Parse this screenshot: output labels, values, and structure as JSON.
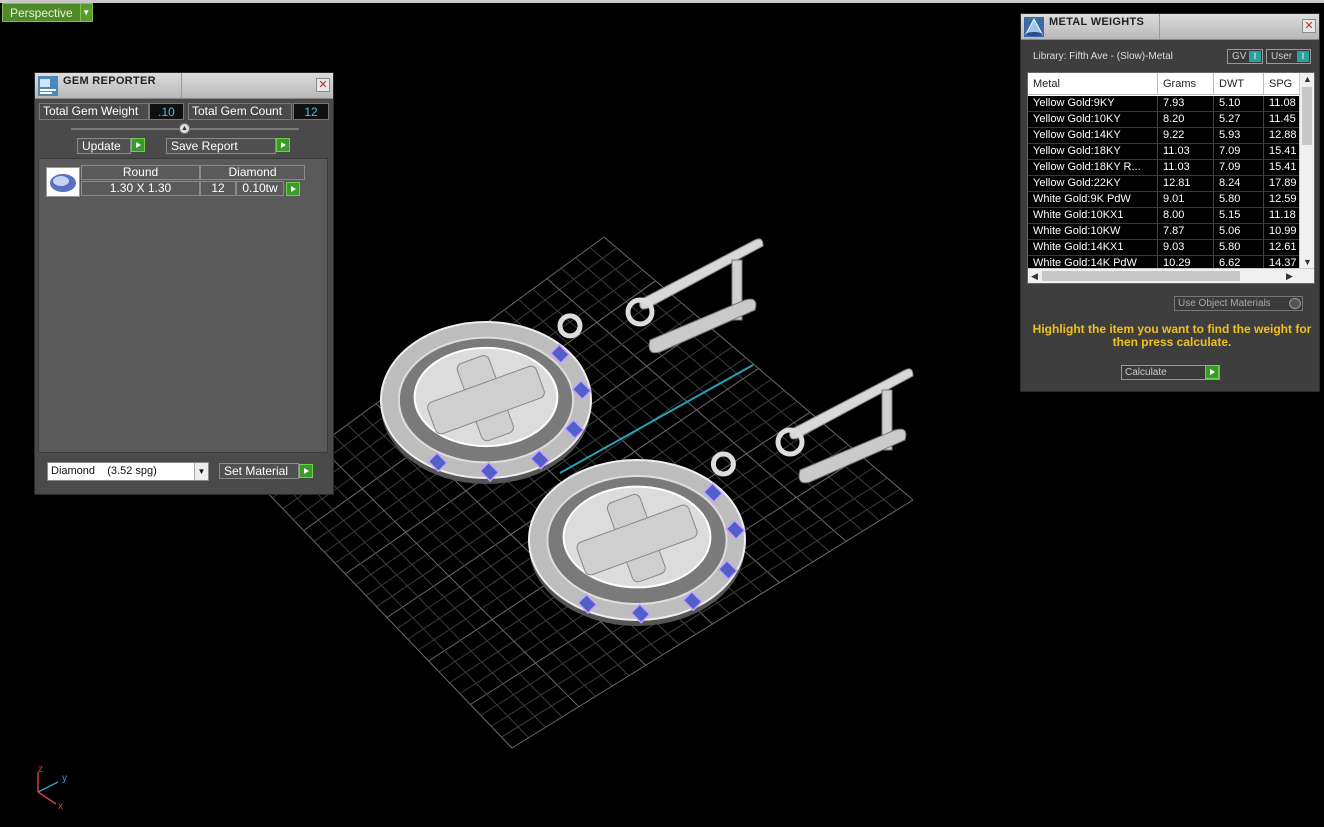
{
  "viewport": {
    "view_label": "Perspective",
    "axes": {
      "z": "z",
      "y": "y",
      "x": "x"
    }
  },
  "gem_reporter": {
    "title": "GEM REPORTER",
    "total_weight_label": "Total Gem Weight",
    "total_weight_value": ".10",
    "total_count_label": "Total Gem Count",
    "total_count_value": "12",
    "update_label": "Update",
    "save_label": "Save Report",
    "columns": {
      "shape": "Round",
      "material": "Diamond"
    },
    "gem": {
      "size": "1.30 X 1.30",
      "count": "12",
      "weight": "0.10tw"
    },
    "material_select": "Diamond    (3.52 spg)",
    "set_material_label": "Set Material"
  },
  "metal_weights": {
    "title": "METAL WEIGHTS",
    "library": "Library: Fifth Ave - (Slow)-Metal",
    "gv_label": "GV",
    "user_label": "User",
    "toggle_symbol": "I",
    "headers": [
      "Metal",
      "Grams",
      "DWT",
      "SPG"
    ],
    "rows": [
      [
        "Yellow Gold:9KY",
        "7.93",
        "5.10",
        "11.08"
      ],
      [
        "Yellow Gold:10KY",
        "8.20",
        "5.27",
        "11.45"
      ],
      [
        "Yellow Gold:14KY",
        "9.22",
        "5.93",
        "12.88"
      ],
      [
        "Yellow Gold:18KY",
        "11.03",
        "7.09",
        "15.41"
      ],
      [
        "Yellow Gold:18KY R...",
        "11.03",
        "7.09",
        "15.41"
      ],
      [
        "Yellow Gold:22KY",
        "12.81",
        "8.24",
        "17.89"
      ],
      [
        "White Gold:9K PdW",
        "9.01",
        "5.80",
        "12.59"
      ],
      [
        "White Gold:10KX1",
        "8.00",
        "5.15",
        "11.18"
      ],
      [
        "White Gold:10KW",
        "7.87",
        "5.06",
        "10.99"
      ],
      [
        "White Gold:14KX1",
        "9.03",
        "5.80",
        "12.61"
      ],
      [
        "White Gold:14K PdW",
        "10.29",
        "6.62",
        "14.37"
      ]
    ],
    "use_object_label": "Use Object Materials",
    "hint": "Highlight the item you want to find the weight for then press calculate.",
    "calculate_label": "Calculate"
  }
}
